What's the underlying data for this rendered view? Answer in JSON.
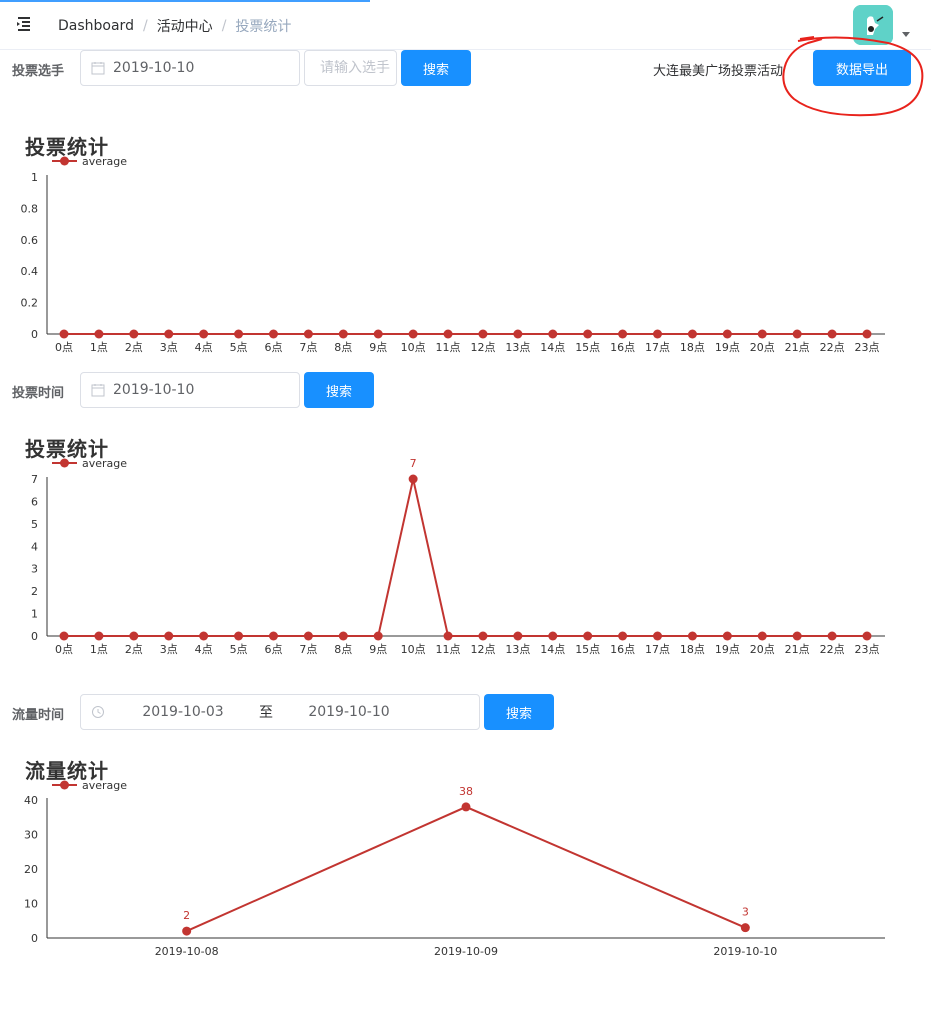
{
  "header": {
    "breadcrumb": [
      "Dashboard",
      "活动中心",
      "投票统计"
    ]
  },
  "filters": {
    "player": {
      "label": "投票选手",
      "date": "2019-10-10",
      "name_placeholder": "请输入选手",
      "search_label": "搜索",
      "activity_name": "大连最美广场投票活动",
      "export_label": "数据导出"
    },
    "vote_time": {
      "label": "投票时间",
      "date": "2019-10-10",
      "search_label": "搜索"
    },
    "traffic_time": {
      "label": "流量时间",
      "start": "2019-10-03",
      "range_sep": "至",
      "end": "2019-10-10",
      "search_label": "搜索"
    }
  },
  "colors": {
    "accent": "#1890ff",
    "series": "#c23531",
    "annotation": "#e8231c"
  },
  "chart_data": [
    {
      "type": "line",
      "title": "投票统计",
      "legend": "average",
      "legend_position": "top-left",
      "categories": [
        "0点",
        "1点",
        "2点",
        "3点",
        "4点",
        "5点",
        "6点",
        "7点",
        "8点",
        "9点",
        "10点",
        "11点",
        "12点",
        "13点",
        "14点",
        "15点",
        "16点",
        "17点",
        "18点",
        "19点",
        "20点",
        "21点",
        "22点",
        "23点"
      ],
      "series": [
        {
          "name": "average",
          "values": [
            0,
            0,
            0,
            0,
            0,
            0,
            0,
            0,
            0,
            0,
            0,
            0,
            0,
            0,
            0,
            0,
            0,
            0,
            0,
            0,
            0,
            0,
            0,
            0
          ]
        }
      ],
      "yticks": [
        "0",
        "0.2",
        "0.4",
        "0.6",
        "0.8",
        "1"
      ],
      "ylim": [
        0,
        1
      ],
      "grid": false,
      "data_labels": false
    },
    {
      "type": "line",
      "title": "投票统计",
      "legend": "average",
      "legend_position": "top-left",
      "categories": [
        "0点",
        "1点",
        "2点",
        "3点",
        "4点",
        "5点",
        "6点",
        "7点",
        "8点",
        "9点",
        "10点",
        "11点",
        "12点",
        "13点",
        "14点",
        "15点",
        "16点",
        "17点",
        "18点",
        "19点",
        "20点",
        "21点",
        "22点",
        "23点"
      ],
      "series": [
        {
          "name": "average",
          "values": [
            0,
            0,
            0,
            0,
            0,
            0,
            0,
            0,
            0,
            0,
            7,
            0,
            0,
            0,
            0,
            0,
            0,
            0,
            0,
            0,
            0,
            0,
            0,
            0
          ]
        }
      ],
      "yticks": [
        "0",
        "1",
        "2",
        "3",
        "4",
        "5",
        "6",
        "7"
      ],
      "ylim": [
        0,
        7
      ],
      "grid": false,
      "data_labels": true,
      "label_threshold": 1
    },
    {
      "type": "line",
      "title": "流量统计",
      "legend": "average",
      "legend_position": "top-left",
      "categories": [
        "2019-10-08",
        "2019-10-09",
        "2019-10-10"
      ],
      "series": [
        {
          "name": "average",
          "values": [
            2,
            38,
            3
          ]
        }
      ],
      "yticks": [
        "0",
        "10",
        "20",
        "30",
        "40"
      ],
      "ylim": [
        0,
        40
      ],
      "grid": false,
      "data_labels": true,
      "label_threshold": 0
    }
  ]
}
